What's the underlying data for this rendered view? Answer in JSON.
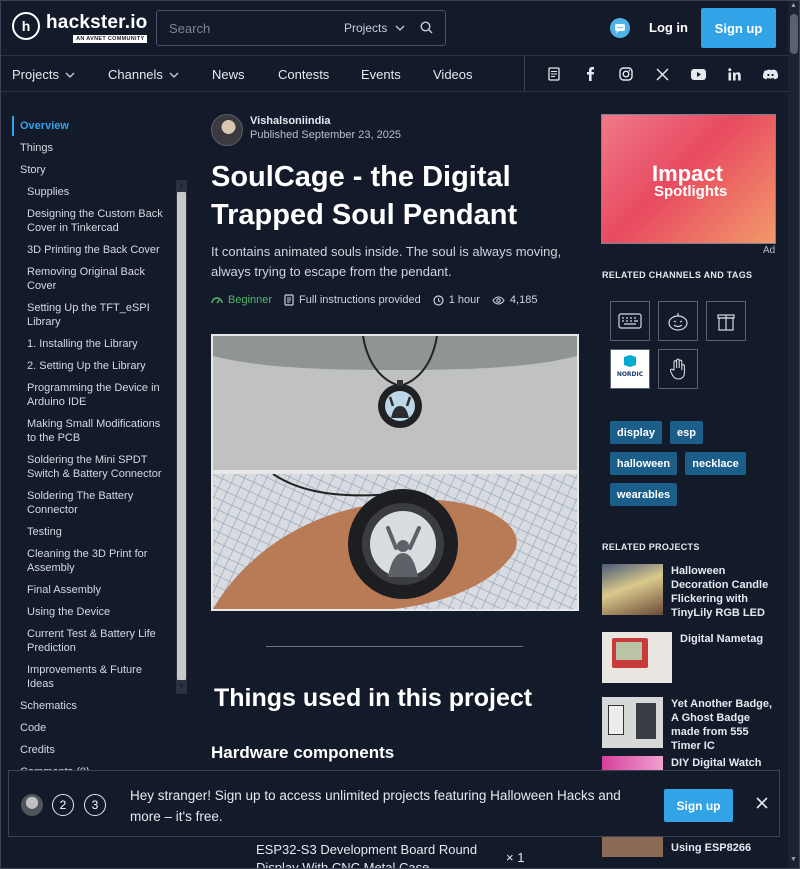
{
  "header": {
    "logo_name": "hackster.io",
    "logo_sub": "AN AVNET COMMUNITY",
    "search_placeholder": "Search",
    "search_scope": "Projects",
    "login": "Log in",
    "signup": "Sign up"
  },
  "nav": {
    "items": [
      "Projects",
      "Channels",
      "News",
      "Contests",
      "Events",
      "Videos"
    ],
    "social": [
      "blog-icon",
      "facebook-icon",
      "instagram-icon",
      "x-icon",
      "youtube-icon",
      "linkedin-icon",
      "discord-icon"
    ]
  },
  "toc": {
    "items": [
      "Overview",
      "Things",
      "Story",
      "Supplies",
      "Designing the Custom Back Cover in Tinkercad",
      "3D Printing the Back Cover",
      "Removing Original Back Cover",
      "Setting Up the TFT_eSPI Library",
      "1. Installing the Library",
      "2. Setting Up the Library",
      "Programming the Device in Arduino IDE",
      "Making Small Modifications to the PCB",
      "Soldering the Mini SPDT Switch & Battery Connector",
      "Soldering The Battery Connector",
      "Testing",
      "Cleaning the 3D Print for Assembly",
      "Final Assembly",
      "Using the Device",
      "Current Test & Battery Life Prediction",
      "Improvements & Future Ideas",
      "Schematics",
      "Code",
      "Credits",
      "Comments (0)"
    ]
  },
  "article": {
    "author": "Vishalsoniindia",
    "published": "Published September 23, 2025",
    "title": "SoulCage - the Digital Trapped Soul Pendant",
    "subtitle": "It contains animated souls inside. The soul is always moving, always trying to escape from the pendant.",
    "level": "Beginner",
    "instructions": "Full instructions provided",
    "duration": "1 hour",
    "views": "4,185",
    "things_title": "Things used in this project",
    "hardware_title": "Hardware components",
    "component_name": "ESP32-S3 Development Board Round Display With CNC Metal Case",
    "component_qty": "× 1"
  },
  "sidebar": {
    "ad_title": "Impact",
    "ad_sub": "Spotlights",
    "ad_label": "Ad",
    "channels_heading": "RELATED CHANNELS AND TAGS",
    "tags": [
      "display",
      "esp",
      "halloween",
      "necklace",
      "wearables"
    ],
    "related_heading": "RELATED PROJECTS",
    "related": [
      "Halloween Decoration Candle Flickering with TinyLily RGB LED",
      "Digital Nametag",
      "Yet Another Badge, A Ghost Badge made from 555 Timer IC",
      "DIY Digital Watch Project",
      "Using ESP8266"
    ]
  },
  "banner": {
    "num1": "2",
    "num2": "3",
    "text": "Hey stranger! Sign up to access unlimited projects featuring Halloween Hacks and more – it's free.",
    "signup": "Sign up"
  },
  "colors": {
    "background": "#131a2a",
    "accent": "#33a3e8",
    "tag": "#1b5e8a",
    "beginner": "#4fb86c"
  }
}
